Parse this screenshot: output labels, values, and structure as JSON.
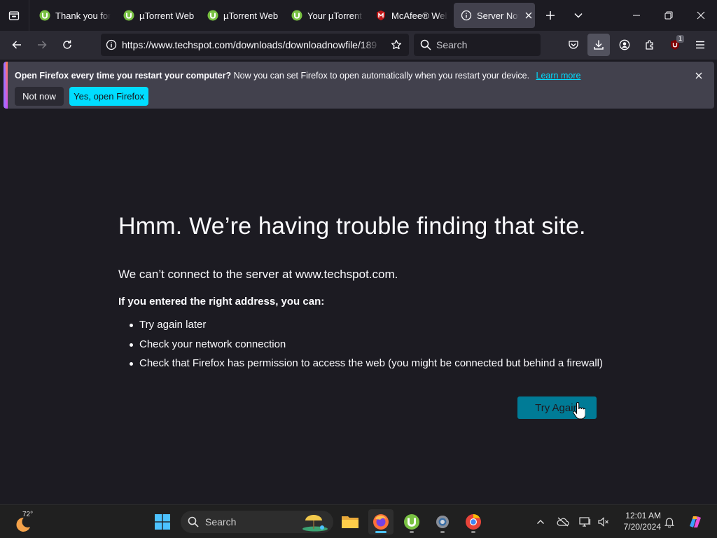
{
  "tabs": [
    {
      "title": "Thank you for",
      "favicon": "utorrent-icon",
      "active": false
    },
    {
      "title": "µTorrent Web",
      "favicon": "utorrent-icon",
      "active": false
    },
    {
      "title": "µTorrent Web",
      "favicon": "utorrent-icon",
      "active": false
    },
    {
      "title": "Your µTorrent",
      "favicon": "utorrent-icon",
      "active": false
    },
    {
      "title": "McAfee® Web",
      "favicon": "mcafee-icon",
      "active": false
    },
    {
      "title": "Server Not F",
      "favicon": "info-icon",
      "active": true
    }
  ],
  "navbar": {
    "url": "https://www.techspot.com/downloads/downloadnowfile/189",
    "search_placeholder": "Search",
    "extension_badge": "1"
  },
  "notification": {
    "bold_text": "Open Firefox every time you restart your computer?",
    "text": "Now you can set Firefox to open automatically when you restart your device.",
    "link": "Learn more",
    "not_now": "Not now",
    "yes_open": "Yes, open Firefox"
  },
  "error_page": {
    "title": "Hmm. We’re having trouble finding that site.",
    "description": "We can’t connect to the server at www.techspot.com.",
    "suggestion_header": "If you entered the right address, you can:",
    "suggestions": [
      "Try again later",
      "Check your network connection",
      "Check that Firefox has permission to access the web (you might be connected but behind a firewall)"
    ],
    "try_again": "Try Again"
  },
  "taskbar": {
    "weather_temp": "72°",
    "search_label": "Search",
    "time": "12:01 AM",
    "date": "7/20/2024"
  },
  "colors": {
    "accent": "#00ddff",
    "try_again_bg": "#007b96",
    "page_bg": "#1c1b22",
    "toolbar_bg": "#2b2a33"
  }
}
